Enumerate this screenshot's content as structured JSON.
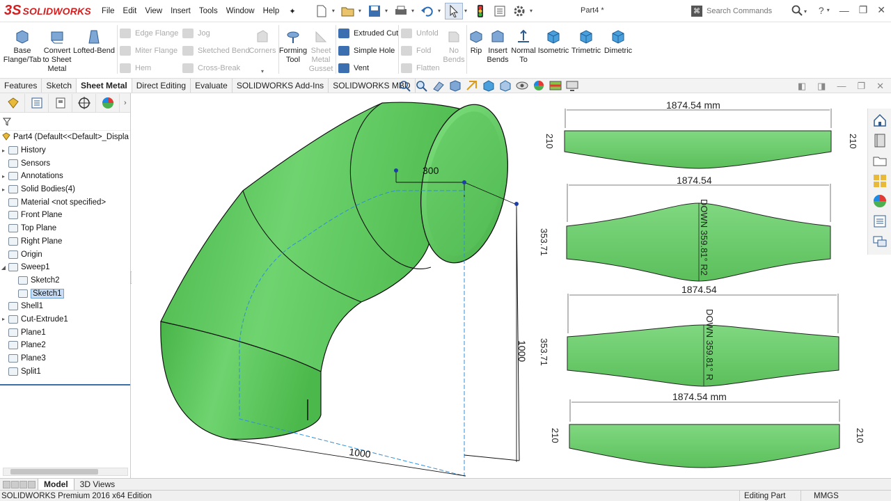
{
  "app": {
    "logo_mark": "3S",
    "logo_text": "SOLIDWORKS",
    "document_title": "Part4 *"
  },
  "menu": [
    "File",
    "Edit",
    "View",
    "Insert",
    "Tools",
    "Window",
    "Help"
  ],
  "search": {
    "placeholder": "Search Commands"
  },
  "ribbon": {
    "big_buttons": [
      {
        "label": "Base\nFlange/Tab",
        "icon": "base-flange-icon",
        "enabled": true
      },
      {
        "label": "Convert\nto Sheet\nMetal",
        "icon": "convert-sheet-metal-icon",
        "enabled": true
      },
      {
        "label": "Lofted-Bend",
        "icon": "lofted-bend-icon",
        "enabled": true
      }
    ],
    "small_col1": [
      {
        "label": "Edge Flange",
        "enabled": false
      },
      {
        "label": "Miter Flange",
        "enabled": false
      },
      {
        "label": "Hem",
        "enabled": false
      }
    ],
    "small_col2": [
      {
        "label": "Jog",
        "enabled": false
      },
      {
        "label": "Sketched Bend",
        "enabled": false
      },
      {
        "label": "Cross-Break",
        "enabled": false
      }
    ],
    "corners": {
      "label": "Corners",
      "enabled": false
    },
    "forming_tool": {
      "label": "Forming\nTool",
      "enabled": true
    },
    "gusset": {
      "label": "Sheet\nMetal\nGusset",
      "enabled": false
    },
    "small_col3": [
      {
        "label": "Extruded Cut",
        "enabled": true
      },
      {
        "label": "Simple Hole",
        "enabled": true
      },
      {
        "label": "Vent",
        "enabled": true
      }
    ],
    "small_col4": [
      {
        "label": "Unfold",
        "enabled": false
      },
      {
        "label": "Fold",
        "enabled": false
      },
      {
        "label": "Flatten",
        "enabled": false
      }
    ],
    "no_bends": {
      "label": "No\nBends",
      "enabled": false
    },
    "right_buttons": [
      {
        "label": "Rip"
      },
      {
        "label": "Insert\nBends"
      },
      {
        "label": "Normal\nTo"
      },
      {
        "label": "Isometric"
      },
      {
        "label": "Trimetric"
      },
      {
        "label": "Dimetric"
      }
    ]
  },
  "tabs": [
    "Features",
    "Sketch",
    "Sheet Metal",
    "Direct Editing",
    "Evaluate",
    "SOLIDWORKS Add-Ins",
    "SOLIDWORKS MBD"
  ],
  "active_tab": "Sheet Metal",
  "tree": {
    "root": "Part4  (Default<<Default>_Displa",
    "filter_icon": "filter-icon",
    "items": [
      {
        "label": "History",
        "expander": true,
        "indent": 0
      },
      {
        "label": "Sensors",
        "expander": false,
        "indent": 0
      },
      {
        "label": "Annotations",
        "expander": true,
        "indent": 0
      },
      {
        "label": "Solid Bodies(4)",
        "expander": true,
        "indent": 0
      },
      {
        "label": "Material <not specified>",
        "expander": false,
        "indent": 0
      },
      {
        "label": "Front Plane",
        "expander": false,
        "indent": 0
      },
      {
        "label": "Top Plane",
        "expander": false,
        "indent": 0
      },
      {
        "label": "Right Plane",
        "expander": false,
        "indent": 0
      },
      {
        "label": "Origin",
        "expander": false,
        "indent": 0
      },
      {
        "label": "Sweep1",
        "expander": true,
        "expanded": true,
        "indent": 0
      },
      {
        "label": "Sketch2",
        "expander": false,
        "indent": 1
      },
      {
        "label": "Sketch1",
        "expander": false,
        "indent": 1,
        "selected": true
      },
      {
        "label": "Shell1",
        "expander": false,
        "indent": 0
      },
      {
        "label": "Cut-Extrude1",
        "expander": true,
        "indent": 0
      },
      {
        "label": "Plane1",
        "expander": false,
        "indent": 0
      },
      {
        "label": "Plane2",
        "expander": false,
        "indent": 0
      },
      {
        "label": "Plane3",
        "expander": false,
        "indent": 0
      },
      {
        "label": "Split1",
        "expander": false,
        "indent": 0
      }
    ]
  },
  "model_tabs": [
    "Model",
    "3D Views"
  ],
  "active_model_tab": "Model",
  "status": {
    "edition": "SOLIDWORKS Premium 2016 x64 Edition",
    "mode": "Editing Part",
    "units": "MMGS"
  },
  "model_dims": {
    "top_width": "300",
    "height": "1000",
    "base_width": "1000"
  },
  "flat_patterns": {
    "p1": {
      "width": "1874.54 mm",
      "left": "210",
      "right": "210"
    },
    "p2": {
      "width": "1874.54",
      "left": "353.71",
      "bend": "DOWN  359.81°  R2"
    },
    "p3": {
      "width": "1874.54",
      "left": "353.71",
      "bend": "DOWN  359.81°  R"
    },
    "p4": {
      "width": "1874.54 mm",
      "left": "210",
      "right": "210"
    }
  },
  "colors": {
    "model_green": "#6fd46f",
    "brand_red": "#d32020",
    "sketch_blue": "#2f8fd8",
    "selection_blue": "#c9def5"
  }
}
